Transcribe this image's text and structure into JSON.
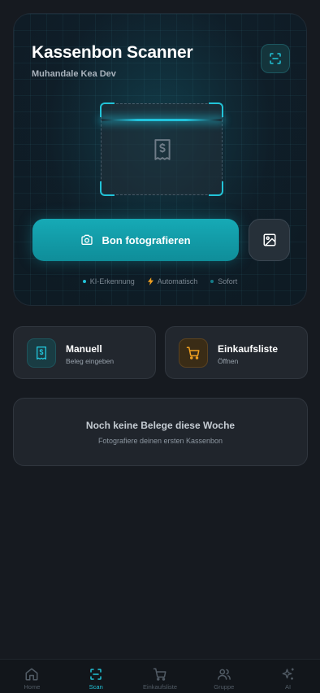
{
  "hero": {
    "title": "Kassenbon Scanner",
    "subtitle": "Muhandale Kea Dev",
    "primary_button": "Bon fotografieren",
    "features": [
      "KI-Erkennung",
      "Automatisch",
      "Sofort"
    ],
    "icons": {
      "scan": "scan-icon",
      "receipt": "receipt-icon",
      "camera": "camera-icon",
      "gallery": "image-icon"
    }
  },
  "cards": [
    {
      "title": "Manuell",
      "subtitle": "Beleg eingeben",
      "icon": "receipt-icon",
      "color": "#22c3d8"
    },
    {
      "title": "Einkaufsliste",
      "subtitle": "Öffnen",
      "icon": "cart-icon",
      "color": "#f0a020"
    }
  ],
  "empty_state": {
    "title": "Noch keine Belege diese Woche",
    "subtitle": "Fotografiere deinen ersten Kassenbon"
  },
  "bottom_nav": {
    "active": "Scan",
    "items": [
      {
        "label": "Home",
        "icon": "home-icon"
      },
      {
        "label": "Scan",
        "icon": "scan-icon"
      },
      {
        "label": "Einkaufsliste",
        "icon": "cart-icon"
      },
      {
        "label": "Gruppe",
        "icon": "users-icon"
      },
      {
        "label": "AI",
        "icon": "sparkles-icon"
      }
    ]
  },
  "colors": {
    "accent": "#22c3d8",
    "cart": "#f0a020",
    "background": "#161a20"
  }
}
